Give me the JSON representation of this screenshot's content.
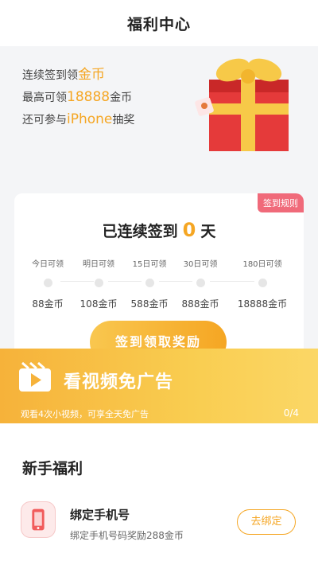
{
  "header": {
    "title": "福利中心"
  },
  "hero": {
    "line1_pre": "连续签到领",
    "line1_hl": "金币",
    "line2_pre": "最高可领",
    "line2_hl": "18888",
    "line2_post": "金币",
    "line3_pre": "还可参与",
    "line3_hl": "iPhone",
    "line3_post": "抽奖"
  },
  "checkin": {
    "rule_label": "签到规则",
    "title_pre": "已连续签到",
    "days": "0",
    "title_post": "天",
    "schedule": [
      {
        "label": "今日可领",
        "reward": "88金币"
      },
      {
        "label": "明日可领",
        "reward": "108金币"
      },
      {
        "label": "15日可领",
        "reward": "588金币"
      },
      {
        "label": "30日可领",
        "reward": "888金币"
      },
      {
        "label": "180日可领",
        "reward": "18888金币"
      }
    ],
    "button_label": "签到领取奖励"
  },
  "video": {
    "title": "看视频免广告",
    "subtitle": "观看4次小视频，可享全天免广告",
    "progress": "0/4"
  },
  "newbie": {
    "section_title": "新手福利",
    "task_name": "绑定手机号",
    "task_desc": "绑定手机号码奖励288金币",
    "task_button": "去绑定"
  },
  "colors": {
    "accent": "#f5a623",
    "tag": "#f06a7a",
    "banner": "#f9cd50"
  },
  "icons": {
    "gift": "gift-box-icon",
    "video": "video-play-icon",
    "phone": "mobile-phone-icon"
  }
}
